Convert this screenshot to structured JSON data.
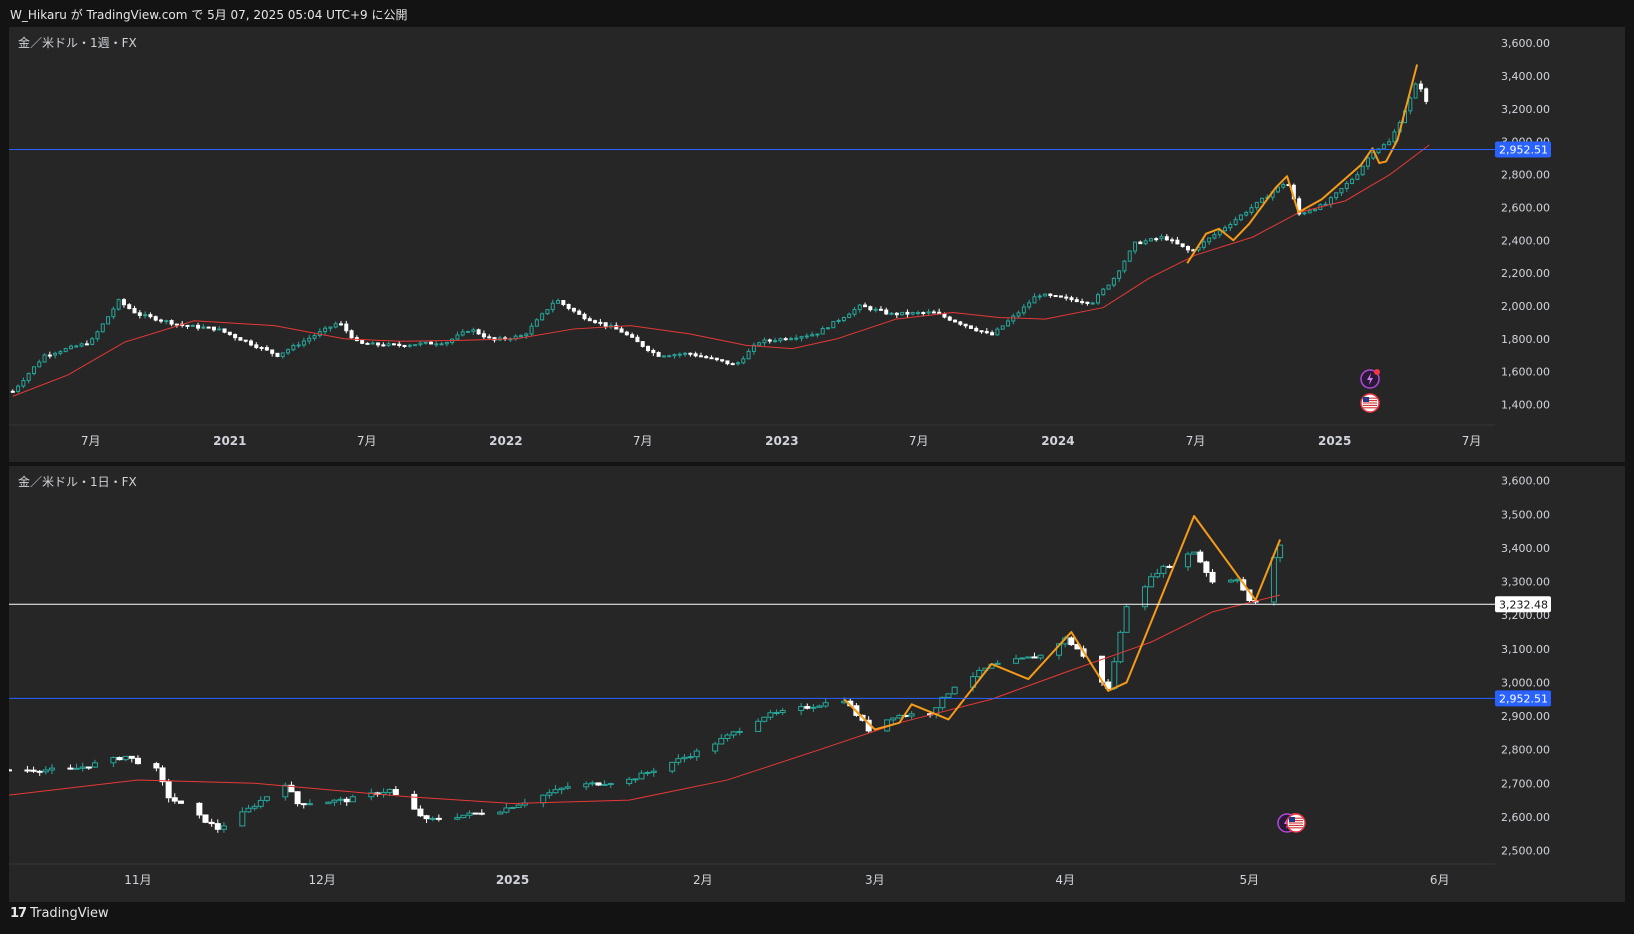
{
  "header": {
    "author": "W_Hikaru",
    "ga": "が",
    "site": "TradingView.com",
    "de": "で",
    "date": "5月 07, 2025 05:04 UTC+9",
    "published": "に公開"
  },
  "footer": {
    "brand": "TradingView",
    "logo_icon": "tradingview-logo-icon"
  },
  "colors": {
    "background": "#131313",
    "pane": "#262626",
    "up_candle": "#26a69a",
    "down_candle": "#ffffff",
    "ma_line": "#e53935",
    "pattern_line": "#f59b1a",
    "support_line": "#2962ff",
    "price_line": "#ffffff"
  },
  "chart_data": [
    {
      "type": "candlestick",
      "title": "金／米ドル・1週・FX",
      "x_tick_labels": [
        "7月",
        "2021",
        "7月",
        "2022",
        "7月",
        "2023",
        "7月",
        "2024",
        "7月",
        "2025",
        "7月"
      ],
      "x_ticks": [
        "2020-07-01",
        "2021-01-01",
        "2021-07-01",
        "2022-01-01",
        "2022-07-01",
        "2023-01-01",
        "2023-07-01",
        "2024-01-01",
        "2024-07-01",
        "2025-01-01",
        "2025-07-01"
      ],
      "xlim": [
        "2020-03-15",
        "2025-08-01"
      ],
      "y_tick_labels": [
        "1,400.00",
        "1,600.00",
        "1,800.00",
        "2,000.00",
        "2,200.00",
        "2,400.00",
        "2,600.00",
        "2,800.00",
        "3,000.00",
        "3,200.00",
        "3,400.00",
        "3,600.00"
      ],
      "y_ticks": [
        1400,
        1600,
        1800,
        2000,
        2200,
        2400,
        2600,
        2800,
        3000,
        3200,
        3400,
        3600
      ],
      "ylim": [
        1275,
        3650
      ],
      "close_path": [
        [
          "2020-03-20",
          1480
        ],
        [
          "2020-05-01",
          1700
        ],
        [
          "2020-07-01",
          1780
        ],
        [
          "2020-08-07",
          2030
        ],
        [
          "2020-09-01",
          1950
        ],
        [
          "2020-11-01",
          1880
        ],
        [
          "2020-12-15",
          1860
        ],
        [
          "2021-03-05",
          1700
        ],
        [
          "2021-05-25",
          1900
        ],
        [
          "2021-06-20",
          1770
        ],
        [
          "2021-08-10",
          1760
        ],
        [
          "2021-10-15",
          1780
        ],
        [
          "2021-11-15",
          1860
        ],
        [
          "2021-12-15",
          1790
        ],
        [
          "2022-01-25",
          1820
        ],
        [
          "2022-03-08",
          2040
        ],
        [
          "2022-04-10",
          1940
        ],
        [
          "2022-06-01",
          1850
        ],
        [
          "2022-07-20",
          1700
        ],
        [
          "2022-09-01",
          1710
        ],
        [
          "2022-11-01",
          1640
        ],
        [
          "2022-12-01",
          1780
        ],
        [
          "2023-02-15",
          1830
        ],
        [
          "2023-04-15",
          2000
        ],
        [
          "2023-05-25",
          1950
        ],
        [
          "2023-07-20",
          1960
        ],
        [
          "2023-10-05",
          1820
        ],
        [
          "2023-11-15",
          1980
        ],
        [
          "2023-12-05",
          2070
        ],
        [
          "2024-02-15",
          2020
        ],
        [
          "2024-03-15",
          2170
        ],
        [
          "2024-04-12",
          2380
        ],
        [
          "2024-05-20",
          2420
        ],
        [
          "2024-06-25",
          2330
        ],
        [
          "2024-08-15",
          2500
        ],
        [
          "2024-10-30",
          2760
        ],
        [
          "2024-11-15",
          2560
        ],
        [
          "2024-12-20",
          2620
        ],
        [
          "2025-01-30",
          2800
        ],
        [
          "2025-02-20",
          2940
        ],
        [
          "2025-03-15",
          3000
        ],
        [
          "2025-04-10",
          3250
        ],
        [
          "2025-04-21",
          3380
        ],
        [
          "2025-05-02",
          3240
        ],
        [
          "2025-05-06",
          3395
        ]
      ],
      "ma_path": [
        [
          "2020-03-20",
          1450
        ],
        [
          "2020-06-01",
          1580
        ],
        [
          "2020-08-15",
          1780
        ],
        [
          "2020-11-15",
          1910
        ],
        [
          "2021-03-01",
          1880
        ],
        [
          "2021-06-01",
          1800
        ],
        [
          "2021-08-15",
          1785
        ],
        [
          "2021-11-01",
          1790
        ],
        [
          "2022-01-15",
          1800
        ],
        [
          "2022-04-01",
          1860
        ],
        [
          "2022-06-15",
          1880
        ],
        [
          "2022-09-01",
          1830
        ],
        [
          "2022-11-15",
          1760
        ],
        [
          "2023-01-15",
          1740
        ],
        [
          "2023-03-15",
          1800
        ],
        [
          "2023-06-01",
          1920
        ],
        [
          "2023-08-15",
          1960
        ],
        [
          "2023-10-15",
          1930
        ],
        [
          "2023-12-15",
          1920
        ],
        [
          "2024-03-01",
          1990
        ],
        [
          "2024-05-01",
          2170
        ],
        [
          "2024-07-01",
          2310
        ],
        [
          "2024-09-15",
          2420
        ],
        [
          "2024-11-15",
          2570
        ],
        [
          "2025-01-15",
          2640
        ],
        [
          "2025-03-15",
          2800
        ],
        [
          "2025-05-06",
          2980
        ]
      ],
      "pattern_path": [
        [
          "2024-06-20",
          2260
        ],
        [
          "2024-07-15",
          2440
        ],
        [
          "2024-08-01",
          2470
        ],
        [
          "2024-08-20",
          2400
        ],
        [
          "2024-09-10",
          2500
        ],
        [
          "2024-10-15",
          2720
        ],
        [
          "2024-10-30",
          2790
        ],
        [
          "2024-11-14",
          2570
        ],
        [
          "2024-12-15",
          2650
        ],
        [
          "2025-02-05",
          2860
        ],
        [
          "2025-02-20",
          2960
        ],
        [
          "2025-03-01",
          2870
        ],
        [
          "2025-03-10",
          2880
        ],
        [
          "2025-03-25",
          3010
        ],
        [
          "2025-04-20",
          3470
        ]
      ],
      "support_line": 2952.51,
      "support_label": "2,952.51",
      "event_icons": [
        "lightning-icon",
        "us-flag-icon"
      ]
    },
    {
      "type": "candlestick",
      "title": "金／米ドル・1日・FX",
      "x_tick_labels": [
        "11月",
        "12月",
        "2025",
        "2月",
        "3月",
        "4月",
        "5月",
        "6月"
      ],
      "x_ticks": [
        "2024-11-01",
        "2024-12-01",
        "2025-01-01",
        "2025-02-01",
        "2025-03-01",
        "2025-04-01",
        "2025-05-01",
        "2025-06-01"
      ],
      "xlim": [
        "2024-10-11",
        "2025-06-10"
      ],
      "y_tick_labels": [
        "2,500.00",
        "2,600.00",
        "2,700.00",
        "2,800.00",
        "2,900.00",
        "3,000.00",
        "3,100.00",
        "3,200.00",
        "3,300.00",
        "3,400.00",
        "3,500.00",
        "3,600.00"
      ],
      "y_ticks": [
        2500,
        2600,
        2700,
        2800,
        2900,
        3000,
        3100,
        3200,
        3300,
        3400,
        3500,
        3600
      ],
      "ylim": [
        2460,
        3620
      ],
      "close_path": [
        [
          "2024-10-11",
          2740
        ],
        [
          "2024-10-21",
          2740
        ],
        [
          "2024-10-30",
          2780
        ],
        [
          "2024-11-04",
          2740
        ],
        [
          "2024-11-06",
          2660
        ],
        [
          "2024-11-14",
          2565
        ],
        [
          "2024-11-18",
          2610
        ],
        [
          "2024-11-25",
          2700
        ],
        [
          "2024-11-27",
          2640
        ],
        [
          "2024-12-05",
          2650
        ],
        [
          "2024-12-12",
          2680
        ],
        [
          "2024-12-18",
          2590
        ],
        [
          "2024-12-30",
          2620
        ],
        [
          "2025-01-10",
          2690
        ],
        [
          "2025-01-20",
          2710
        ],
        [
          "2025-02-01",
          2800
        ],
        [
          "2025-02-11",
          2900
        ],
        [
          "2025-02-24",
          2950
        ],
        [
          "2025-02-28",
          2860
        ],
        [
          "2025-03-04",
          2900
        ],
        [
          "2025-03-10",
          2910
        ],
        [
          "2025-03-14",
          2990
        ],
        [
          "2025-03-20",
          3050
        ],
        [
          "2025-03-28",
          3080
        ],
        [
          "2025-04-01",
          3130
        ],
        [
          "2025-04-03",
          3100
        ],
        [
          "2025-04-08",
          2980
        ],
        [
          "2025-04-11",
          3230
        ],
        [
          "2025-04-16",
          3330
        ],
        [
          "2025-04-22",
          3390
        ],
        [
          "2025-04-25",
          3300
        ],
        [
          "2025-04-29",
          3310
        ],
        [
          "2025-05-01",
          3240
        ],
        [
          "2025-05-02",
          3240
        ],
        [
          "2025-05-06",
          3410
        ]
      ],
      "ma_path": [
        [
          "2024-10-11",
          2665
        ],
        [
          "2024-11-01",
          2710
        ],
        [
          "2024-11-20",
          2700
        ],
        [
          "2024-12-15",
          2660
        ],
        [
          "2025-01-01",
          2640
        ],
        [
          "2025-01-20",
          2650
        ],
        [
          "2025-02-05",
          2710
        ],
        [
          "2025-02-20",
          2800
        ],
        [
          "2025-03-05",
          2880
        ],
        [
          "2025-03-20",
          2950
        ],
        [
          "2025-04-01",
          3030
        ],
        [
          "2025-04-15",
          3120
        ],
        [
          "2025-04-25",
          3210
        ],
        [
          "2025-05-06",
          3260
        ]
      ],
      "pattern_path": [
        [
          "2025-02-24",
          2950
        ],
        [
          "2025-03-01",
          2860
        ],
        [
          "2025-03-05",
          2880
        ],
        [
          "2025-03-07",
          2935
        ],
        [
          "2025-03-13",
          2890
        ],
        [
          "2025-03-20",
          3055
        ],
        [
          "2025-03-26",
          3010
        ],
        [
          "2025-04-02",
          3150
        ],
        [
          "2025-04-08",
          2975
        ],
        [
          "2025-04-11",
          3000
        ],
        [
          "2025-04-22",
          3495
        ],
        [
          "2025-05-02",
          3245
        ],
        [
          "2025-05-06",
          3425
        ]
      ],
      "support_line": 2952.51,
      "support_label": "2,952.51",
      "price_line": 3232.48,
      "price_label": "3,232.48",
      "event_icons": [
        "lightning-icon",
        "us-flag-icon"
      ]
    }
  ]
}
